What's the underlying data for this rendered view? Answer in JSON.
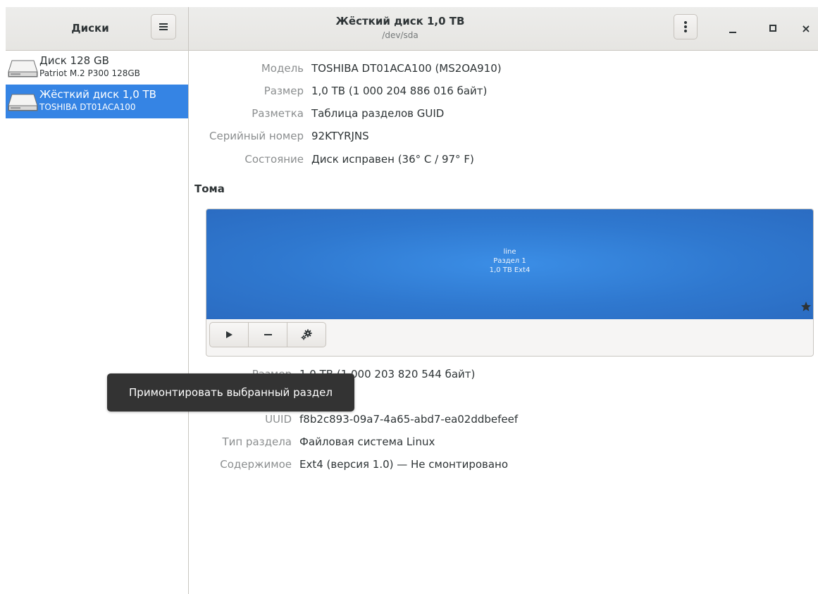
{
  "header": {
    "app_title": "Диски",
    "window_title": "Жёсткий диск 1,0 TB",
    "window_subtitle": "/dev/sda",
    "close_glyph": "×"
  },
  "sidebar": {
    "items": [
      {
        "name": "Диск 128 GB",
        "model": "Patriot M.2 P300 128GB",
        "selected": false
      },
      {
        "name": "Жёсткий диск 1,0 TB",
        "model": "TOSHIBA DT01ACA100",
        "selected": true
      }
    ]
  },
  "disk": {
    "props": [
      {
        "label": "Модель",
        "value": "TOSHIBA DT01ACA100 (MS2OA910)"
      },
      {
        "label": "Размер",
        "value": "1,0 TB (1 000 204 886 016 байт)"
      },
      {
        "label": "Разметка",
        "value": "Таблица разделов GUID"
      },
      {
        "label": "Серийный номер",
        "value": "92KTYRJNS"
      },
      {
        "label": "Состояние",
        "value": "Диск исправен (36° C / 97° F)"
      }
    ]
  },
  "volumes": {
    "title": "Тома",
    "partition": {
      "line1": "line",
      "line2": "Раздел 1",
      "line3": "1,0 TB Ext4"
    },
    "toolbar": {
      "mount_icon": "play-icon",
      "remove_icon": "minus-icon",
      "settings_icon": "gears-icon"
    }
  },
  "partition_props": [
    {
      "label": "Размер",
      "value": "1,0 TB (1 000 203 820 544 байт)"
    },
    {
      "label": "UUID",
      "value": "f8b2c893-09a7-4a65-abd7-ea02ddbefeef"
    },
    {
      "label": "Тип раздела",
      "value": "Файловая система Linux"
    },
    {
      "label": "Содержимое",
      "value": "Ext4 (версия 1.0) — Не смонтировано"
    }
  ],
  "tooltip": {
    "text": "Примонтировать выбранный раздел"
  },
  "colors": {
    "accent": "#3584e4",
    "partition": "#2f78cf",
    "tooltip_bg": "#333333"
  }
}
